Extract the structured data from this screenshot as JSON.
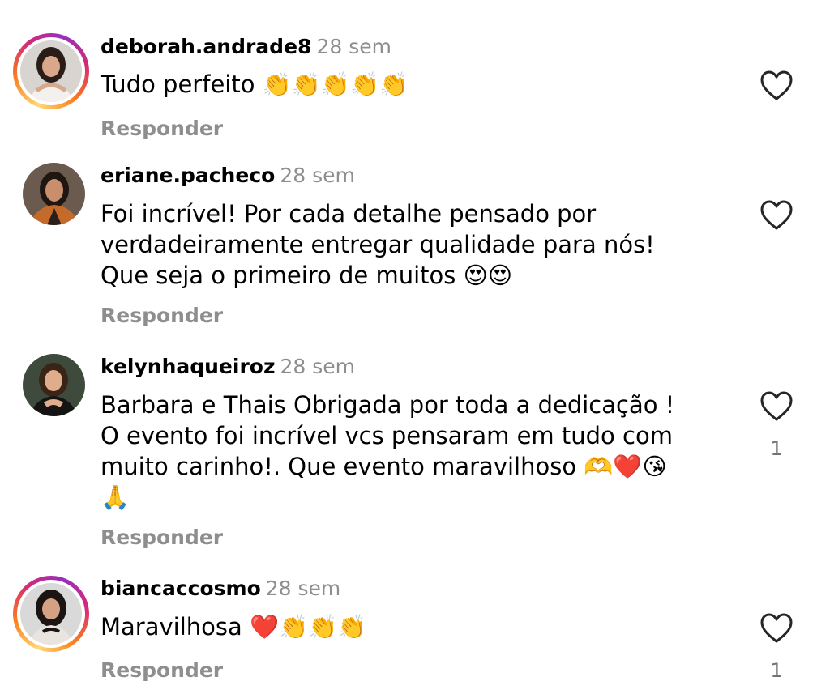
{
  "comments": [
    {
      "username": "deborah.andrade8",
      "time": "28 sem",
      "text": "Tudo perfeito 👏👏👏👏👏",
      "reply_label": "Responder",
      "likes": "",
      "has_story_ring": true
    },
    {
      "username": "eriane.pacheco",
      "time": "28 sem",
      "text": "Foi incrível! Por cada detalhe pensado por\nverdadeiramente entregar qualidade para nós!\nQue seja o primeiro de muitos 😍😍",
      "reply_label": "Responder",
      "likes": "",
      "has_story_ring": false
    },
    {
      "username": "kelynhaqueiroz",
      "time": "28 sem",
      "text": "Barbara e Thais Obrigada por toda a dedicação !\nO evento foi incrível vcs pensaram em tudo com\nmuito carinho!. Que evento maravilhoso 🫶❤️😘\n🙏",
      "reply_label": "Responder",
      "likes": "1",
      "has_story_ring": false
    },
    {
      "username": "biancaccosmo",
      "time": "28 sem",
      "text": "Maravilhosa ❤️👏👏👏",
      "reply_label": "Responder",
      "likes": "1",
      "has_story_ring": true
    }
  ],
  "icons": {
    "like": "heart-outline-icon"
  },
  "colors": {
    "muted": "#8e8e8e",
    "ring_start": "#feda75",
    "ring_end": "#962fbf"
  }
}
